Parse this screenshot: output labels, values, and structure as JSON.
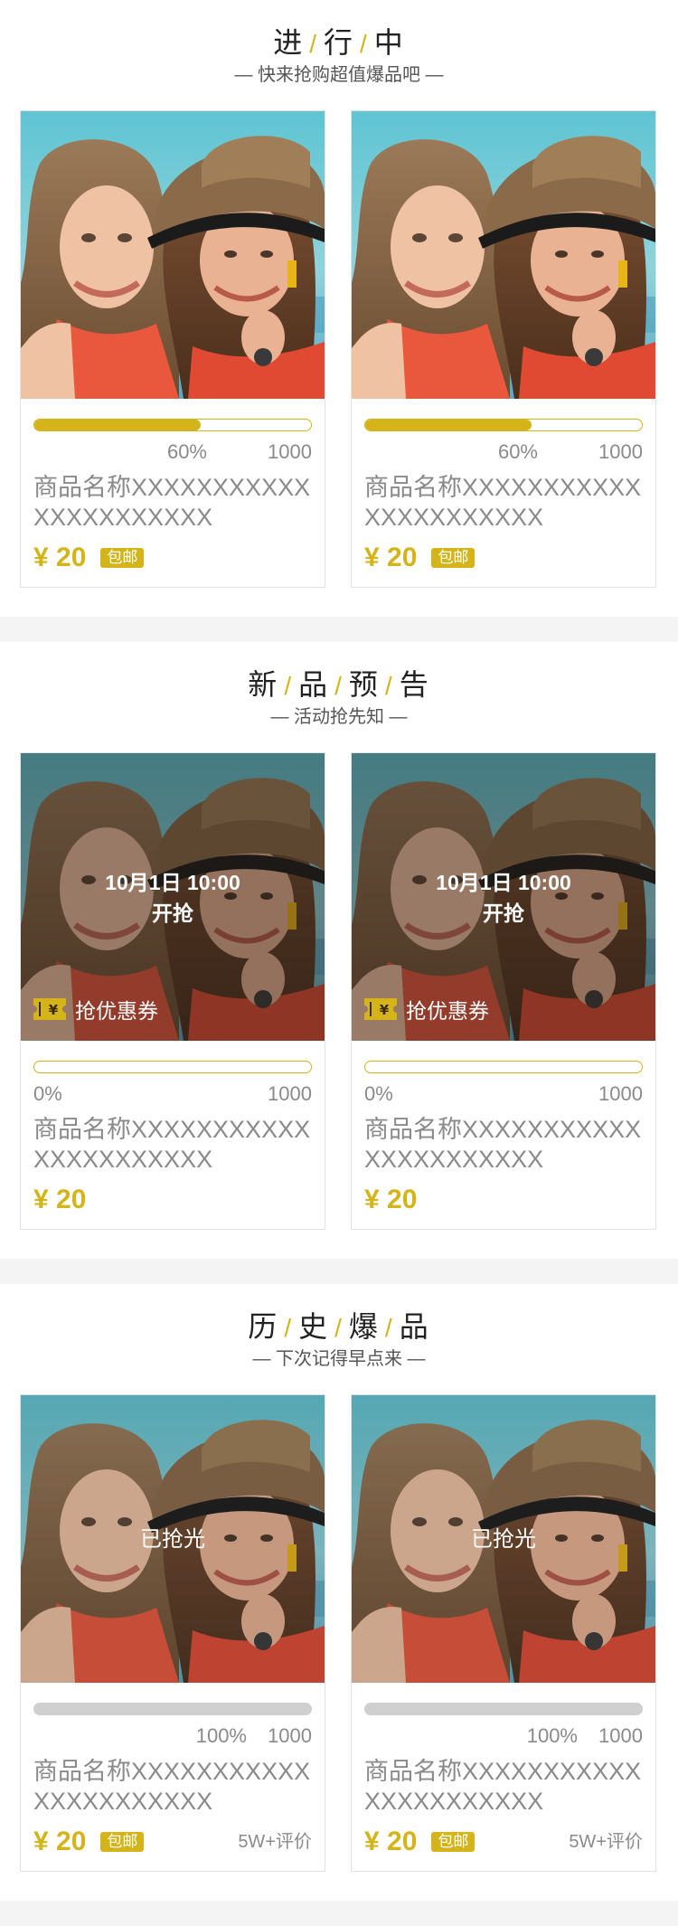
{
  "sections": [
    {
      "title_chars": [
        "进",
        "行",
        "中"
      ],
      "subtitle": "— 快来抢购超值爆品吧 —",
      "products": [
        {
          "progress_pct": 60,
          "percent_text": "60%",
          "total": "1000",
          "name": "商品名称XXXXXXXXXXXXXXXXXXXXXX",
          "price": "¥ 20",
          "badge": "包邮"
        },
        {
          "progress_pct": 60,
          "percent_text": "60%",
          "total": "1000",
          "name": "商品名称XXXXXXXXXXXXXXXXXXXXXX",
          "price": "¥ 20",
          "badge": "包邮"
        }
      ]
    },
    {
      "title_chars": [
        "新",
        "品",
        "预",
        "告"
      ],
      "subtitle": "— 活动抢先知 —",
      "products": [
        {
          "progress_pct": 0,
          "percent_text": "0%",
          "total": "1000",
          "name": "商品名称XXXXXXXXXXXXXXXXXXXXXX",
          "price": "¥ 20",
          "start_date": "10月1日 10:00",
          "start_label": "开抢",
          "coupon_label": "抢优惠券",
          "coupon_icon": "coupon-ticket-icon"
        },
        {
          "progress_pct": 0,
          "percent_text": "0%",
          "total": "1000",
          "name": "商品名称XXXXXXXXXXXXXXXXXXXXXX",
          "price": "¥ 20",
          "start_date": "10月1日 10:00",
          "start_label": "开抢",
          "coupon_label": "抢优惠券",
          "coupon_icon": "coupon-ticket-icon"
        }
      ]
    },
    {
      "title_chars": [
        "历",
        "史",
        "爆",
        "品"
      ],
      "subtitle": "— 下次记得早点来 —",
      "products": [
        {
          "progress_pct": 100,
          "percent_text": "100%",
          "total": "1000",
          "name": "商品名称XXXXXXXXXXXXXXXXXXXXXX",
          "price": "¥ 20",
          "badge": "包邮",
          "status": "已抢光",
          "reviews": "5W+评价"
        },
        {
          "progress_pct": 100,
          "percent_text": "100%",
          "total": "1000",
          "name": "商品名称XXXXXXXXXXXXXXXXXXXXXX",
          "price": "¥ 20",
          "badge": "包邮",
          "status": "已抢光",
          "reviews": "5W+评价"
        }
      ]
    }
  ],
  "colors": {
    "accent": "#d4b419",
    "text_grey": "#8a8a8a",
    "section_gap": "#f4f4f4",
    "border": "#e2e2e2",
    "sold_out_bar": "#cfcfcf"
  }
}
